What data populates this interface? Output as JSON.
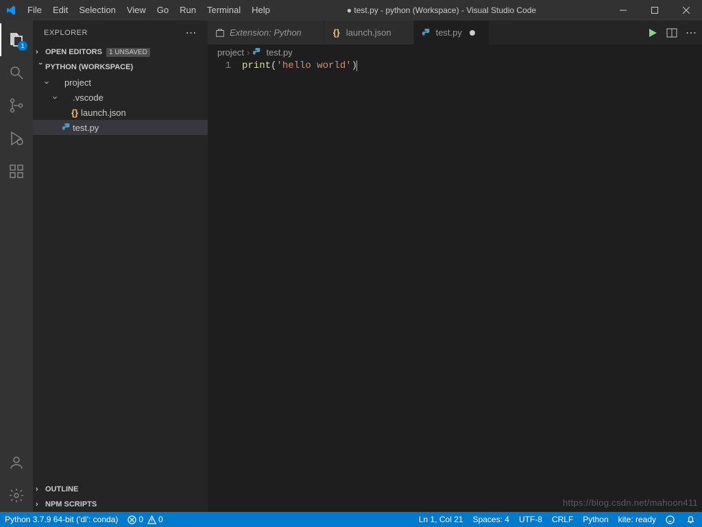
{
  "window": {
    "menu": [
      "File",
      "Edit",
      "Selection",
      "View",
      "Go",
      "Run",
      "Terminal",
      "Help"
    ],
    "title_dirty_prefix": "●",
    "title": "test.py - python (Workspace) - Visual Studio Code"
  },
  "activity": {
    "explorer_badge": "1"
  },
  "explorer": {
    "title": "EXPLORER",
    "open_editors": "OPEN EDITORS",
    "unsaved_badge": "1 UNSAVED",
    "workspace": "PYTHON (WORKSPACE)",
    "tree": [
      {
        "name": "project",
        "kind": "folder",
        "depth": 0,
        "expanded": true
      },
      {
        "name": ".vscode",
        "kind": "folder",
        "depth": 1,
        "expanded": true
      },
      {
        "name": "launch.json",
        "kind": "json",
        "depth": 2
      },
      {
        "name": "test.py",
        "kind": "python",
        "depth": 1,
        "selected": true
      }
    ],
    "outline": "OUTLINE",
    "npm": "NPM SCRIPTS"
  },
  "tabs": [
    {
      "label": "Extension: Python",
      "kind": "ext",
      "italic": true,
      "dirty": false,
      "active": false
    },
    {
      "label": "launch.json",
      "kind": "json",
      "italic": false,
      "dirty": false,
      "active": false
    },
    {
      "label": "test.py",
      "kind": "python",
      "italic": false,
      "dirty": true,
      "active": true
    }
  ],
  "breadcrumb": {
    "folder": "project",
    "file": "test.py"
  },
  "editor": {
    "line_number": "1",
    "code": {
      "fn": "print",
      "open": "(",
      "str": "'hello world'",
      "close": ")"
    }
  },
  "status": {
    "python": "Python 3.7.9 64-bit ('dl': conda)",
    "errors": "0",
    "warnings": "0",
    "cursor": "Ln 1, Col 21",
    "spaces": "Spaces: 4",
    "encoding": "UTF-8",
    "eol": "CRLF",
    "language": "Python",
    "kite": "kite: ready"
  },
  "watermark": "https://blog.csdn.net/mahoon411"
}
